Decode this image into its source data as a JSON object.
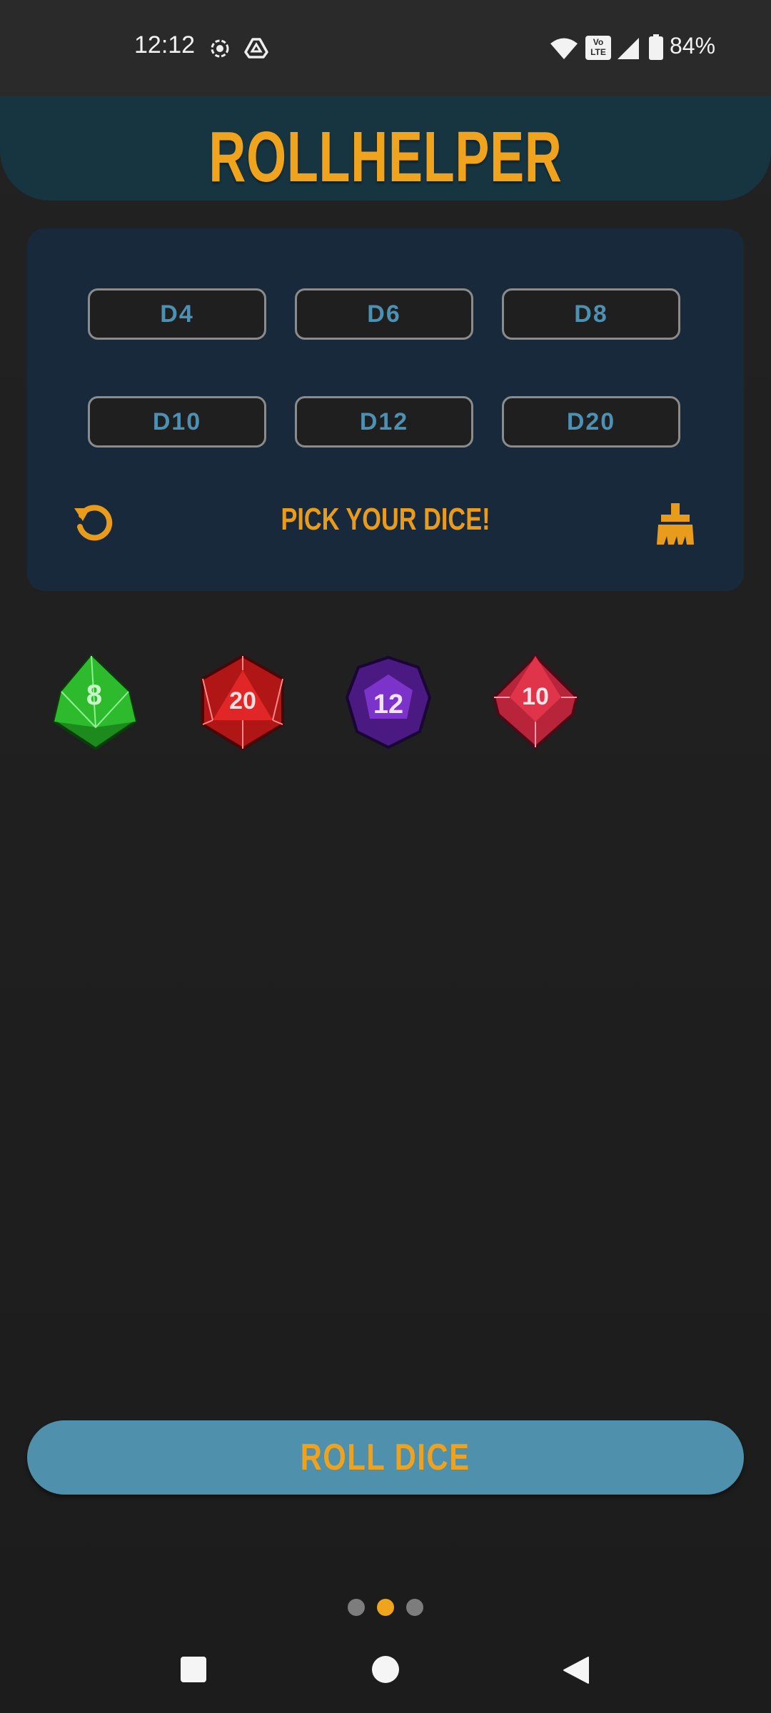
{
  "status_bar": {
    "time": "12:12",
    "battery_percent": "84%",
    "volte_text": "Vo LTE",
    "icons": [
      "screen-record-icon",
      "drive-icon",
      "wifi-icon",
      "volte-icon",
      "signal-icon",
      "battery-icon"
    ]
  },
  "header": {
    "title": "ROLLHELPER"
  },
  "picker": {
    "buttons": [
      "D4",
      "D6",
      "D8",
      "D10",
      "D12",
      "D20"
    ],
    "instruction": "PICK YOUR DICE!",
    "reset_icon": "reset-icon",
    "clear_icon": "broom-icon"
  },
  "selected_dice": [
    {
      "type": "d8",
      "face": "8",
      "color": "#2dbb2d"
    },
    {
      "type": "d20",
      "face": "20",
      "color": "#e02626"
    },
    {
      "type": "d12",
      "face": "12",
      "color": "#7c33c9"
    },
    {
      "type": "d10",
      "face": "10",
      "color": "#e0344a"
    }
  ],
  "roll_button": {
    "label": "ROLL DICE"
  },
  "pager": {
    "count": 3,
    "active_index": 1
  },
  "colors": {
    "accent": "#f0a31d",
    "panel": "#17293a",
    "header": "#173441",
    "button_text": "#4d90b2",
    "roll_bg": "#4f90ad"
  }
}
